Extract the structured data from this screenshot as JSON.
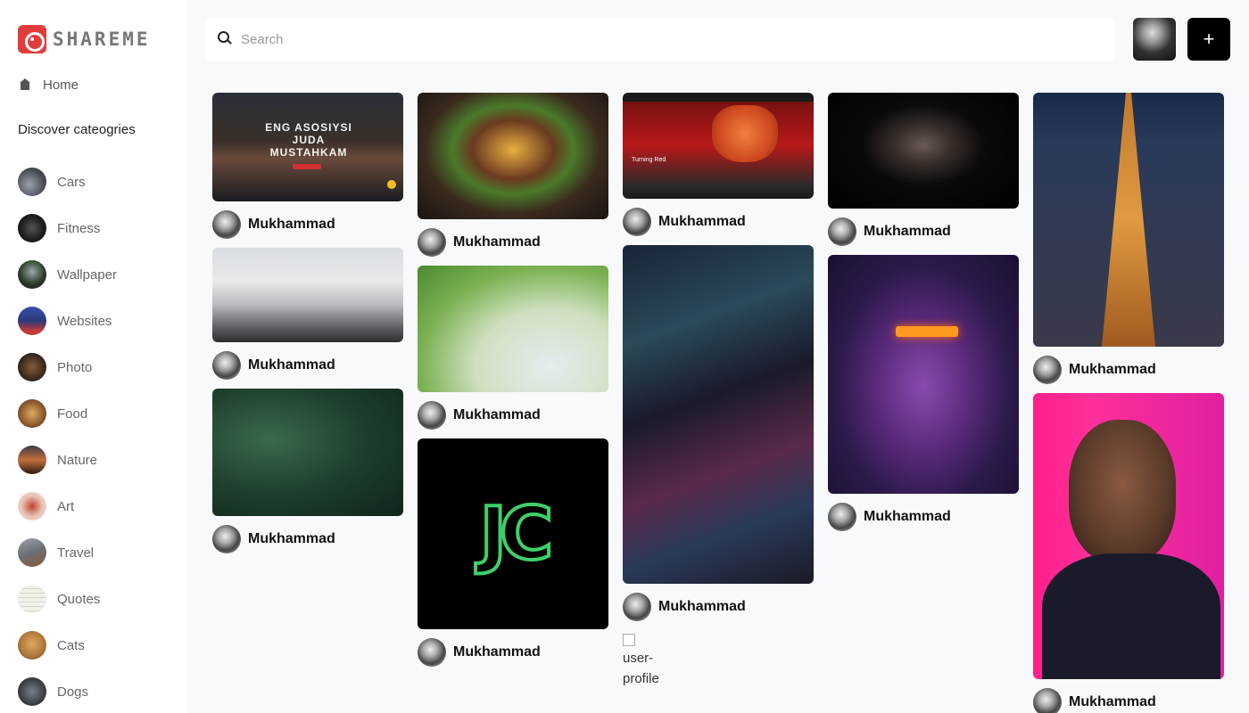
{
  "app": {
    "logo_text": "SHAREME"
  },
  "sidebar": {
    "home_label": "Home",
    "discover_label": "Discover cateogries",
    "categories": [
      {
        "label": "Cars",
        "color": "#4a4f57"
      },
      {
        "label": "Fitness",
        "color": "#1b1b1b"
      },
      {
        "label": "Wallpaper",
        "color": "#2e3d2a"
      },
      {
        "label": "Websites",
        "color": "#2b3a78"
      },
      {
        "label": "Photo",
        "color": "#3a2a1e"
      },
      {
        "label": "Food",
        "color": "#8a5a2c"
      },
      {
        "label": "Nature",
        "color": "#7a4a30"
      },
      {
        "label": "Art",
        "color": "#c9a090"
      },
      {
        "label": "Travel",
        "color": "#6a6f75"
      },
      {
        "label": "Quotes",
        "color": "#e8e6df"
      },
      {
        "label": "Cats",
        "color": "#b07a3c"
      },
      {
        "label": "Dogs",
        "color": "#3c4148"
      }
    ]
  },
  "search": {
    "placeholder": "Search",
    "value": ""
  },
  "header": {
    "add_label": "+"
  },
  "pins": {
    "author": "Mukhammad",
    "col1": [
      {
        "image_text": "ENG ASOSIYSI JUDA MUSTAHKAM"
      },
      {
        "image_text": ""
      },
      {
        "image_text": ""
      }
    ],
    "col2": [
      {
        "image_text": ""
      },
      {
        "image_text": ""
      },
      {
        "image_text": "JC"
      }
    ],
    "col3": [
      {
        "image_text": "Turning Red"
      },
      {
        "image_text": ""
      }
    ],
    "col4": [
      {
        "image_text": ""
      },
      {
        "image_text": ""
      }
    ],
    "col5": [
      {
        "image_text": ""
      },
      {
        "image_text": ""
      }
    ],
    "broken_alt": "user-profile"
  }
}
